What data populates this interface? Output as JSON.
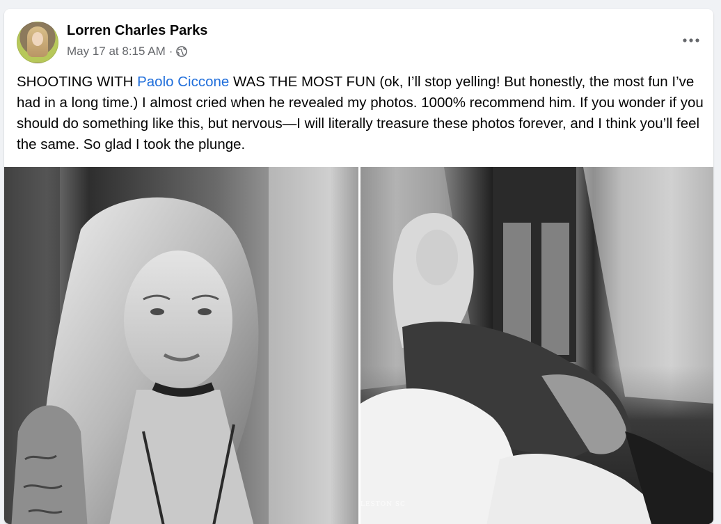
{
  "post": {
    "author": "Lorren Charles Parks",
    "timestamp": "May 17 at 8:15 AM",
    "separator": "·",
    "audience_icon": "globe-icon",
    "more_icon": "more-options-icon",
    "text_before_mention": "SHOOTING WITH ",
    "mention": "Paolo Ciccone",
    "text_after_mention": " WAS THE MOST FUN (ok, I’ll stop yelling! But honestly, the most fun I’ve had in a long time.) I almost cried when he revealed my photos. 1000% recommend him. If you wonder if you should do something like this, but nervous—I will literally treasure these photos forever, and I think you’ll feel the same. So glad I took the plunge."
  },
  "photos": [
    {
      "name": "photo-portrait-left",
      "style": "black-and-white"
    },
    {
      "name": "photo-window-right",
      "style": "black-and-white",
      "watermark": "LESTON SC"
    }
  ],
  "colors": {
    "page_bg": "#f0f2f5",
    "card_bg": "#ffffff",
    "text_primary": "#050505",
    "text_secondary": "#65676b",
    "link": "#216fdb"
  }
}
